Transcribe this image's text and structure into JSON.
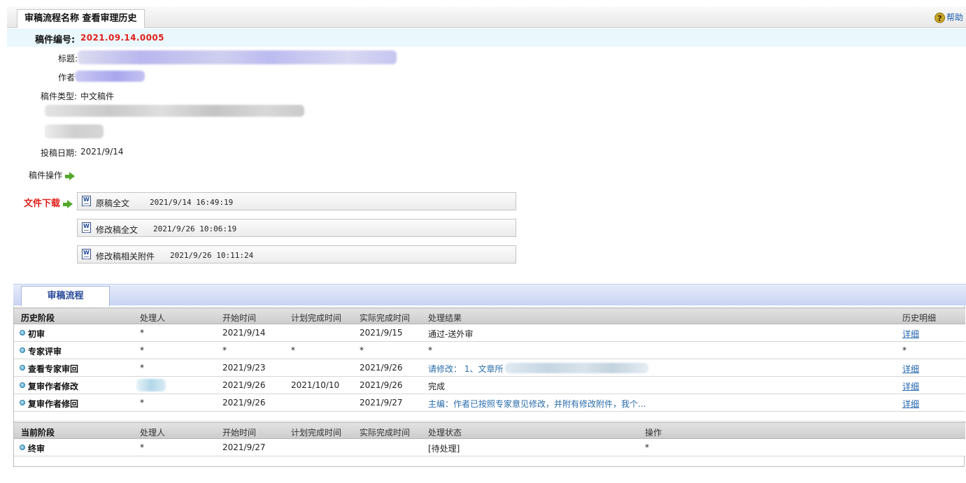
{
  "header": {
    "title": "审稿流程名称 查看审理历史",
    "help_label": "帮助",
    "manuscript_id_label": "稿件编号:",
    "manuscript_id_value": "2021.09.14.0005"
  },
  "info": {
    "title_label": "标题:",
    "author_label": "作者",
    "type_label": "稿件类型:",
    "type_value": "中文稿件",
    "submit_date_label": "投稿日期:",
    "submit_date_value": "2021/9/14",
    "operations_label": "稿件操作",
    "download_label": "文件下载"
  },
  "files": [
    {
      "name": "原稿全文",
      "time": "2021/9/14 16:49:19"
    },
    {
      "name": "修改稿全文",
      "time": "2021/9/26 10:06:19"
    },
    {
      "name": "修改稿相关附件",
      "time": "2021/9/26 10:11:24"
    }
  ],
  "workflow": {
    "tab_label": "审稿流程",
    "history_headers": [
      "历史阶段",
      "处理人",
      "开始时间",
      "计划完成时间",
      "实际完成时间",
      "处理结果",
      "历史明细"
    ],
    "history_rows": [
      {
        "stage": "初审",
        "handler": "*",
        "start": "2021/9/14",
        "planned": "",
        "actual": "2021/9/15",
        "result": "通过-送外审",
        "detail": "详细"
      },
      {
        "stage": "专家评审",
        "handler": "*",
        "start": "*",
        "planned": "*",
        "actual": "*",
        "result": "*",
        "detail": "*"
      },
      {
        "stage": "查看专家审回",
        "handler": "*",
        "start": "2021/9/23",
        "planned": "",
        "actual": "2021/9/26",
        "result": "请修改： 1、文章所",
        "detail": "详细"
      },
      {
        "stage": "复审作者修改",
        "handler": "",
        "start": "2021/9/26",
        "planned": "2021/10/10",
        "actual": "2021/9/26",
        "result": "完成",
        "detail": "详细"
      },
      {
        "stage": "复审作者修回",
        "handler": "*",
        "start": "2021/9/26",
        "planned": "",
        "actual": "2021/9/27",
        "result": "主编：作者已按照专家意见修改，并附有修改附件，我个...",
        "detail": "详细"
      }
    ],
    "current_headers": [
      "当前阶段",
      "处理人",
      "开始时间",
      "计划完成时间",
      "实际完成时间",
      "处理状态",
      "操作"
    ],
    "current_rows": [
      {
        "stage": "终审",
        "handler": "*",
        "start": "2021/9/27",
        "planned": "",
        "actual": "",
        "status": "[待处理]",
        "operation": "*"
      }
    ]
  }
}
